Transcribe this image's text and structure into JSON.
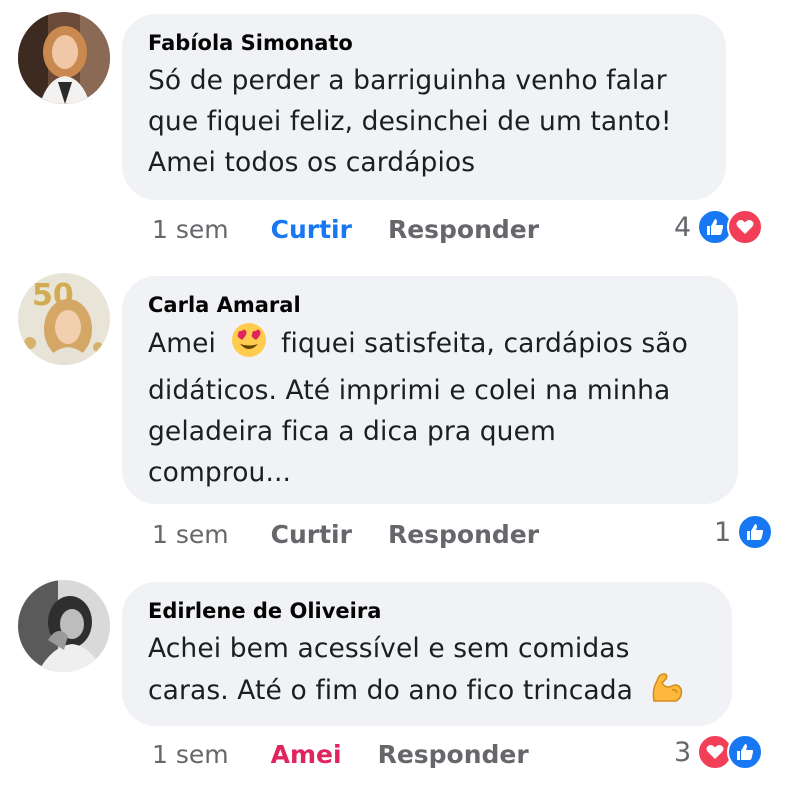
{
  "colors": {
    "like_blue": "#1877f2",
    "love_red": "#f33e58",
    "bubble_bg": "#f0f2f5",
    "muted": "#65676b"
  },
  "comments": [
    {
      "author": "Fabíola Simonato",
      "lines": [
        "Só de perder a barriguinha venho falar",
        "que fiquei feliz, desinchei de um tanto!",
        "Amei todos os cardápios"
      ],
      "time": "1 sem",
      "reaction_action": "Curtir",
      "reply_action": "Responder",
      "reaction_count": "4",
      "reaction_icons": [
        "like-icon",
        "love-icon"
      ]
    },
    {
      "author": "Carla Amaral",
      "lines": [
        "fiquei satisfeita, cardápios são",
        "didáticos. Até imprimi e colei na minha",
        "geladeira fica a dica pra quem",
        "comprou..."
      ],
      "first_word": "Amei",
      "emoji": "heart-eyes-emoji",
      "time": "1 sem",
      "reaction_action": "Curtir",
      "reply_action": "Responder",
      "reaction_count": "1",
      "reaction_icons": [
        "like-icon"
      ]
    },
    {
      "author": "Edirlene de Oliveira",
      "lines": [
        "Achei bem acessível e sem comidas",
        "caras. Até o fim do ano fico trincada"
      ],
      "emoji": "flexed-biceps-emoji",
      "time": "1 sem",
      "reaction_action": "Amei",
      "reply_action": "Responder",
      "reaction_count": "3",
      "reaction_icons": [
        "love-icon",
        "like-icon"
      ]
    }
  ]
}
